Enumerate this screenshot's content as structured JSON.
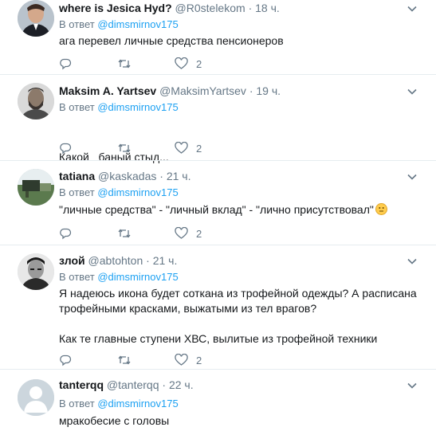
{
  "reply_prefix": "В ответ",
  "tweets": [
    {
      "name": "where is Jesica Hyd?",
      "handle": "@R0stelekom",
      "time": "18 ч.",
      "reply_to": "@dimsmirnov175",
      "text": [
        "ага перевел личные средства пенсионеров"
      ],
      "likes": "2",
      "avatar": "dark-suit-man-photo"
    },
    {
      "name": "Maksim A. Yartsev",
      "handle": "@MaksimYartsev",
      "time": "19 ч.",
      "reply_to": "@dimsmirnov175",
      "text": [
        "Какой   баный стыд..."
      ],
      "likes": "2",
      "avatar": "bearded-man-photo"
    },
    {
      "name": "tatiana",
      "handle": "@kaskadas",
      "time": "21 ч.",
      "reply_to": "@dimsmirnov175",
      "text": [
        "\"личные средства\" - \"личный вклад\" - \"лично присутствовал\""
      ],
      "likes": "2",
      "avatar": "outdoor-scene-photo",
      "emoji": "neutral-face-emoji"
    },
    {
      "name": "злой",
      "handle": "@abtohton",
      "time": "21 ч.",
      "reply_to": "@dimsmirnov175",
      "text": [
        "Я надеюсь икона будет соткана из трофейной одежды? А расписана",
        "трофейными красками, выжатыми из тел врагов?",
        "",
        "Как те главные ступени ХВС, вылитые из трофейной техники"
      ],
      "likes": "2",
      "avatar": "black-white-portrait-photo"
    },
    {
      "name": "tanterqq",
      "handle": "@tanterqq",
      "time": "22 ч.",
      "reply_to": "@dimsmirnov175",
      "text": [
        "мракобесие с головы"
      ],
      "avatar": "default-avatar"
    }
  ],
  "colors": {
    "accent": "#1da1f2",
    "muted": "#657786",
    "text": "#14171a",
    "separator": "#e6ecf0"
  }
}
